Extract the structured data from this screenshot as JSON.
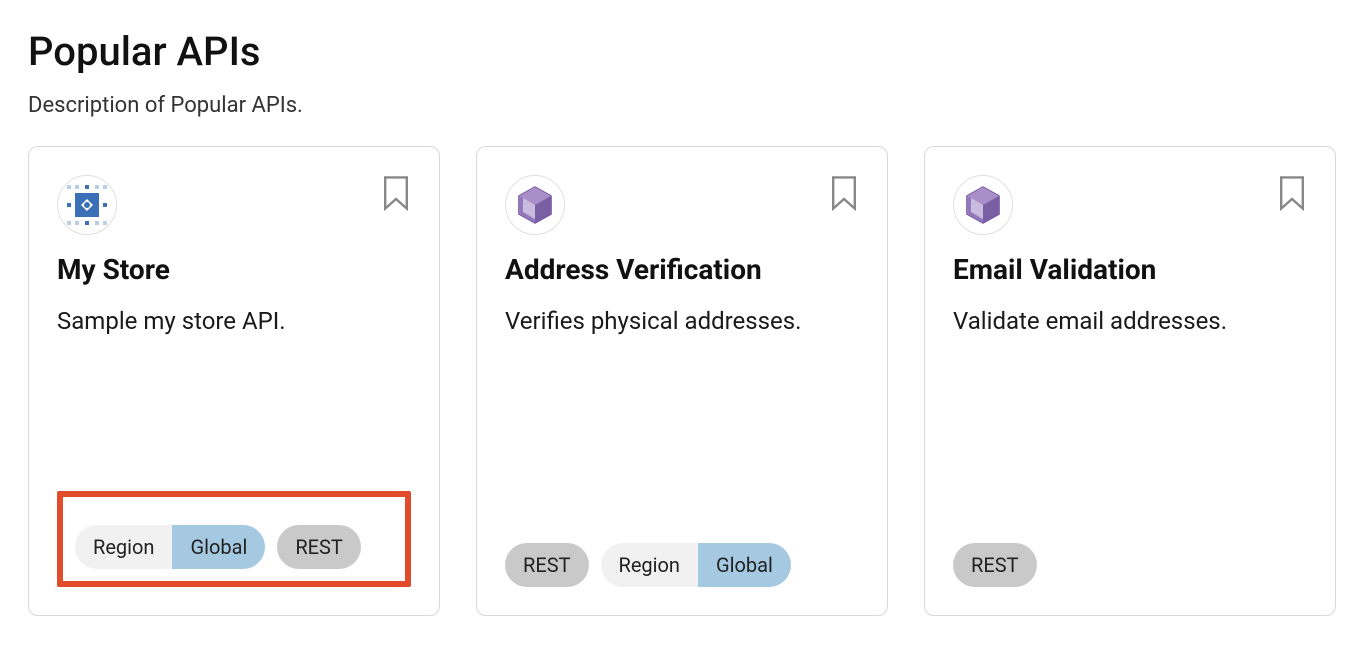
{
  "page": {
    "title": "Popular APIs",
    "description": "Description of Popular APIs."
  },
  "cards": [
    {
      "title": "My Store",
      "description": "Sample my store API.",
      "icon": "mystore",
      "badges": [
        {
          "type": "split",
          "left": "Region",
          "right": "Global"
        },
        {
          "type": "single",
          "label": "REST"
        }
      ],
      "highlight_badges": true
    },
    {
      "title": "Address Verification",
      "description": "Verifies physical addresses.",
      "icon": "cube",
      "badges": [
        {
          "type": "single",
          "label": "REST"
        },
        {
          "type": "split",
          "left": "Region",
          "right": "Global"
        }
      ],
      "highlight_badges": false
    },
    {
      "title": "Email Validation",
      "description": "Validate email addresses.",
      "icon": "cube",
      "badges": [
        {
          "type": "single",
          "label": "REST"
        }
      ],
      "highlight_badges": false
    }
  ]
}
